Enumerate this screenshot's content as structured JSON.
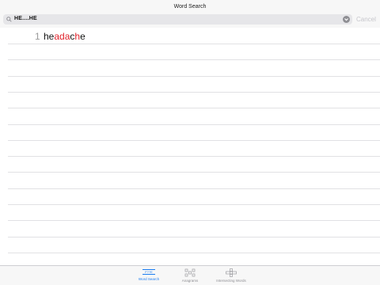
{
  "header": {
    "title": "Word Search"
  },
  "search": {
    "query": "HE....HE",
    "cancel_label": "Cancel"
  },
  "results": [
    {
      "index": "1",
      "parts": [
        {
          "text": "he",
          "hl": false
        },
        {
          "text": "ada",
          "hl": true
        },
        {
          "text": "c",
          "hl": false
        },
        {
          "text": "h",
          "hl": true
        },
        {
          "text": "e",
          "hl": false
        }
      ]
    }
  ],
  "tabs": [
    {
      "label": "Word Search",
      "icon": "word-search-icon",
      "active": true
    },
    {
      "label": "Anagrams",
      "icon": "anagrams-icon",
      "active": false
    },
    {
      "label": "Intersecting Words",
      "icon": "intersecting-words-icon",
      "active": false
    }
  ],
  "colors": {
    "accent": "#1a7cf0",
    "highlight": "#e0222a"
  }
}
